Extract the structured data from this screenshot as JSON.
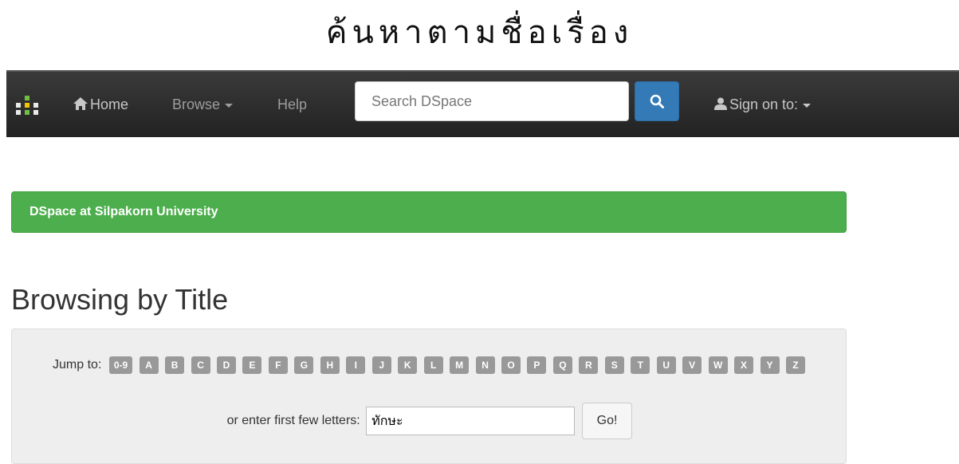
{
  "page_heading": "ค้นหาตามชื่อเรื่อง",
  "navbar": {
    "logo_icon": "dspace-logo-icon",
    "home_icon": "home-icon",
    "home_label": "Home",
    "browse_label": "Browse",
    "help_label": "Help",
    "search_placeholder": "Search DSpace",
    "search_icon": "search-icon",
    "user_icon": "user-icon",
    "sign_on_label": "Sign on to:"
  },
  "banner": {
    "text": "DSpace at Silpakorn University",
    "color": "#4cae4c"
  },
  "browse_title": "Browsing by Title",
  "jump": {
    "label": "Jump to:",
    "letters": [
      "0-9",
      "A",
      "B",
      "C",
      "D",
      "E",
      "F",
      "G",
      "H",
      "I",
      "J",
      "K",
      "L",
      "M",
      "N",
      "O",
      "P",
      "Q",
      "R",
      "S",
      "T",
      "U",
      "V",
      "W",
      "X",
      "Y",
      "Z"
    ],
    "enter_label": "or enter first few letters:",
    "input_value": "ทักษะ",
    "go_label": "Go!"
  },
  "colors": {
    "navbar_bg": "#222222",
    "search_button": "#337ab7",
    "letter_badge": "#999999"
  }
}
